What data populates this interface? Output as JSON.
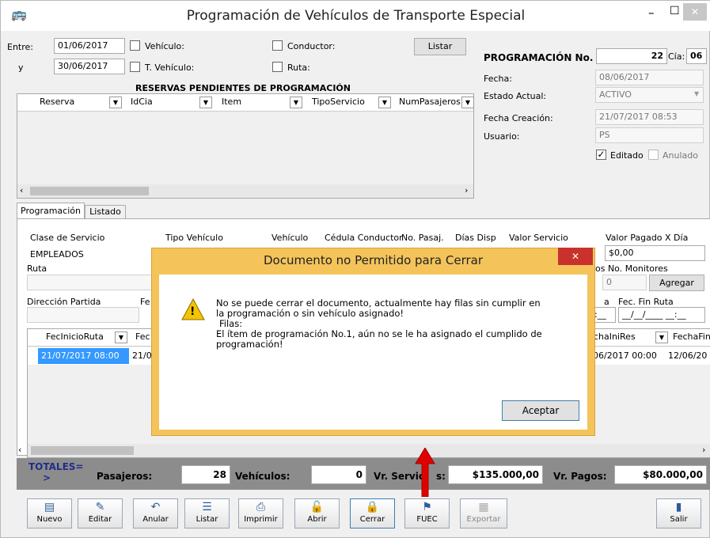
{
  "window": {
    "title": "Programación de Vehículos de Transporte Especial",
    "minimize": "–",
    "maximize": "☐",
    "close": "✕"
  },
  "filter": {
    "entre_label": "Entre:",
    "fecha_ini": "01/06/2017",
    "y_label": "y",
    "fecha_fin": "30/06/2017",
    "vehiculo_label": "Vehículo:",
    "tvehiculo_label": "T. Vehículo:",
    "conductor_label": "Conductor:",
    "ruta_label": "Ruta:",
    "listar_label": "Listar"
  },
  "reservas": {
    "title": "RESERVAS PENDIENTES DE PROGRAMACIÓN",
    "columns": [
      "Reserva",
      "IdCia",
      "Item",
      "TipoServicio",
      "NumPasajeros"
    ]
  },
  "info": {
    "prog_label": "PROGRAMACIÓN No.",
    "prog_value": "22",
    "cia_label": "Cía:",
    "cia_value": "06",
    "fecha_label": "Fecha:",
    "fecha_value": "08/06/2017",
    "estado_label": "Estado Actual:",
    "estado_value": "ACTIVO",
    "creacion_label": "Fecha Creación:",
    "creacion_value": "21/07/2017 08:53",
    "usuario_label": "Usuario:",
    "usuario_value": "PS",
    "editado_label": "Editado",
    "anulado_label": "Anulado"
  },
  "tabs": [
    "Programación",
    "Listado"
  ],
  "form": {
    "clase_label": "Clase de Servicio",
    "clase_value": "EMPLEADOS",
    "tipo_label": "Tipo Vehículo",
    "vehiculo_label": "Vehículo",
    "cedula_label": "Cédula Conductor",
    "pasaj_label": "No. Pasaj.",
    "dias_label": "Días Disp",
    "valor_label": "Valor Servicio",
    "valor_pagado_label": "Valor Pagado X Día",
    "valor_pagado_value": "$0,00",
    "ruta_label": "Ruta",
    "monitores_label": "os No. Monitores",
    "monitores_value": "0",
    "agregar_label": "Agregar",
    "direccion_label": "Dirección Partida",
    "fe_label": "Fe",
    "a_label": "a",
    "fec_fin_label": "Fec. Fin Ruta",
    "fec_fin_partial": ":__",
    "fec_fin_value": "__/__/____ __:__"
  },
  "grid": {
    "col1": "FecInicioRuta",
    "col2": "Fec",
    "col3": "chaIniRes",
    "col4": "FechaFin",
    "row1": {
      "c1": "21/07/2017 08:00",
      "c2": "21/0",
      "c3": "06/2017 00:00",
      "c4": "12/06/20"
    }
  },
  "totals": {
    "label": "TOTALES=",
    "arrow": ">",
    "pasajeros_label": "Pasajeros:",
    "pasajeros_value": "28",
    "vehiculos_label": "Vehículos:",
    "vehiculos_value": "0",
    "vr_servicios_label": "Vr. Servici",
    "vr_servicios_tail": "s:",
    "vr_servicios_value": "$135.000,00",
    "vr_pagos_label": "Vr. Pagos:",
    "vr_pagos_value": "$80.000,00"
  },
  "toolbar": [
    "Nuevo",
    "Editar",
    "Anular",
    "Listar",
    "Imprimir",
    "Abrir",
    "Cerrar",
    "FUEC",
    "Exportar",
    "Salir"
  ],
  "dialog": {
    "title": "Documento no Permitido para Cerrar",
    "message_1": "No se puede cerrar el documento, actualmente hay filas sin cumplir en",
    "message_2": "la programación o sin vehículo asignado!",
    "message_3": "Filas:",
    "message_4": "El ítem de programación No.1, aún no se le ha asignado el cumplido de",
    "message_5": "programación!",
    "ok_label": "Aceptar",
    "warning_glyph": "!",
    "close": "✕"
  },
  "colors": {
    "dialog_frame": "#f4c45b",
    "dialog_close": "#c9322c",
    "selected_row": "#3399ff",
    "totals_bar": "#8c8c8c",
    "arrow": "#e00000"
  }
}
